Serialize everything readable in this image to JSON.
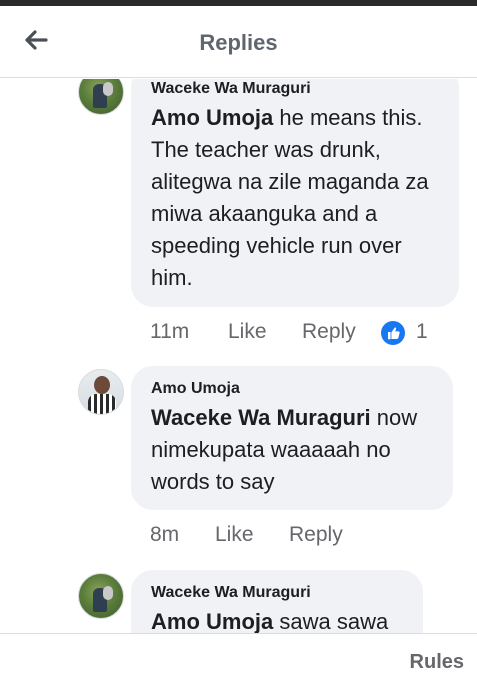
{
  "header": {
    "title": "Replies",
    "back_icon": "back-arrow-icon"
  },
  "comments": [
    {
      "author": "Waceke Wa Muraguri",
      "mention": "Amo Umoja",
      "text": " he means this. The teacher was drunk, alitegwa na zile maganda za miwa akaanguka and a speeding vehicle run over him.",
      "time": "11m",
      "like_label": "Like",
      "reply_label": "Reply",
      "reaction_icon": "thumbs-up-icon",
      "reaction_count": "1"
    },
    {
      "author": "Amo Umoja",
      "mention": "Waceke Wa Muraguri",
      "text": " now nimekupata  waaaaah no words to say",
      "time": "8m",
      "like_label": "Like",
      "reply_label": "Reply"
    },
    {
      "author": "Waceke Wa Muraguri",
      "mention": "Amo Umoja",
      "text": " sawa sawa"
    }
  ],
  "footer": {
    "rules_label": "Rules"
  },
  "colors": {
    "accent": "#1877f2",
    "bubble": "#f0f2f5",
    "muted": "#65676b"
  }
}
